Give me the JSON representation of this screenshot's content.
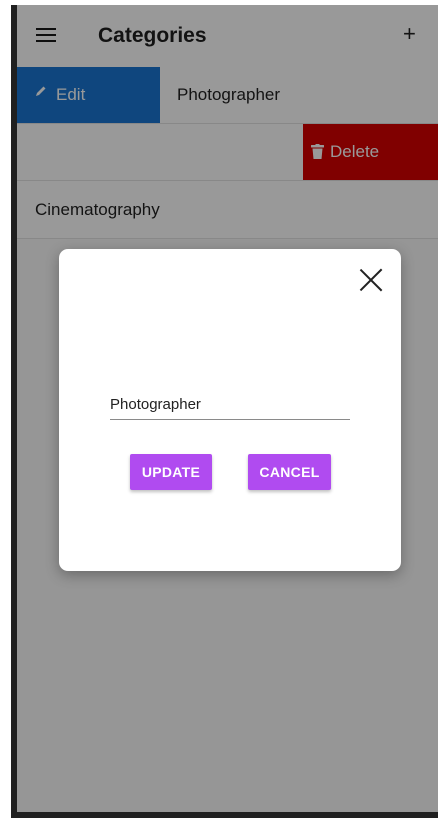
{
  "app_bar": {
    "title": "Categories",
    "menu_icon": "hamburger-menu-icon",
    "add_label": "+"
  },
  "list": {
    "items": [
      {
        "label": "Photographer",
        "action_label": "Edit",
        "action_icon": "pencil-icon",
        "action_color": "#1976d2"
      },
      {
        "label": "",
        "action_label": "Delete",
        "action_icon": "trash-icon",
        "action_color": "#d50000"
      },
      {
        "label": "Cinematography"
      }
    ]
  },
  "dialog": {
    "input_value": "Photographer",
    "update_label": "UPDATE",
    "cancel_label": "CANCEL",
    "button_color": "#b04bf0",
    "close_icon": "close-icon"
  }
}
